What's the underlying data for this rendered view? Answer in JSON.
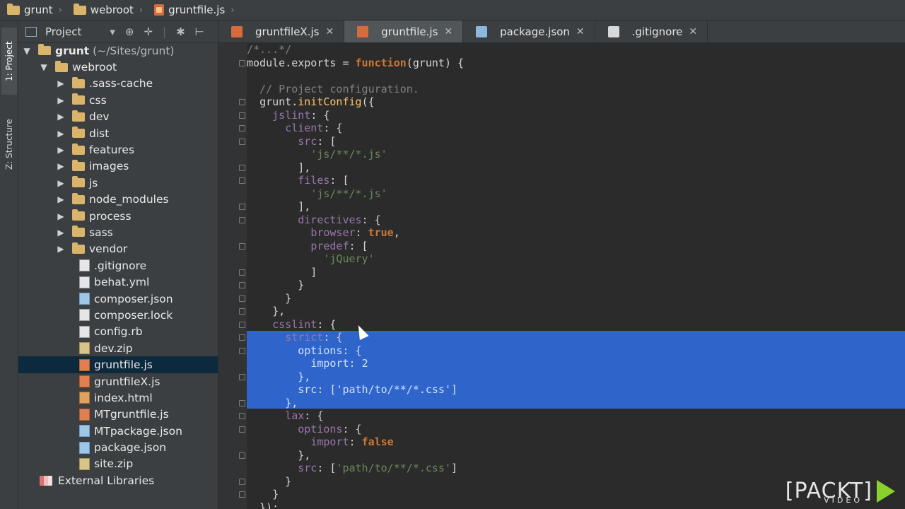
{
  "breadcrumb": [
    "grunt",
    "webroot",
    "gruntfile.js"
  ],
  "toolwindows": {
    "project": "1: Project",
    "structure": "Z: Structure"
  },
  "project_panel": {
    "title": "Project",
    "root": "grunt",
    "root_path": "(~/Sites/grunt)",
    "webroot": "webroot",
    "folders": [
      ".sass-cache",
      "css",
      "dev",
      "dist",
      "features",
      "images",
      "js",
      "node_modules",
      "process",
      "sass",
      "vendor"
    ],
    "files": [
      {
        "name": ".gitignore",
        "type": "text"
      },
      {
        "name": "behat.yml",
        "type": "text"
      },
      {
        "name": "composer.json",
        "type": "json"
      },
      {
        "name": "composer.lock",
        "type": "text"
      },
      {
        "name": "config.rb",
        "type": "text"
      },
      {
        "name": "dev.zip",
        "type": "zip"
      },
      {
        "name": "gruntfile.js",
        "type": "js"
      },
      {
        "name": "gruntfileX.js",
        "type": "js"
      },
      {
        "name": "index.html",
        "type": "html"
      },
      {
        "name": "MTgruntfile.js",
        "type": "js"
      },
      {
        "name": "MTpackage.json",
        "type": "json"
      },
      {
        "name": "package.json",
        "type": "json"
      },
      {
        "name": "site.zip",
        "type": "zip"
      }
    ],
    "selected": "gruntfile.js",
    "external": "External Libraries"
  },
  "tabs": [
    {
      "label": "gruntfileX.js",
      "type": "js",
      "active": false
    },
    {
      "label": "gruntfile.js",
      "type": "js",
      "active": true
    },
    {
      "label": "package.json",
      "type": "json",
      "active": false
    },
    {
      "label": ".gitignore",
      "type": "txt",
      "active": false
    }
  ],
  "code_lines": [
    "/*...*/",
    "module.exports = function(grunt) {",
    "",
    "  // Project configuration.",
    "  grunt.initConfig({",
    "    jslint: {",
    "      client: {",
    "        src: [",
    "          'js/**/*.js'",
    "        ],",
    "        files: [",
    "          'js/**/*.js'",
    "        ],",
    "        directives: {",
    "          browser: true,",
    "          predef: [",
    "            'jQuery'",
    "          ]",
    "        }",
    "      }",
    "    },",
    "    csslint: {",
    "      strict: {",
    "        options: {",
    "          import: 2",
    "        },",
    "        src: ['path/to/**/*.css']",
    "      },",
    "      lax: {",
    "        options: {",
    "          import: false",
    "        },",
    "        src: ['path/to/**/*.css']",
    "      }",
    "    }",
    "  });"
  ],
  "watermark": {
    "brand": "PACKT",
    "sub": "VIDEO"
  }
}
